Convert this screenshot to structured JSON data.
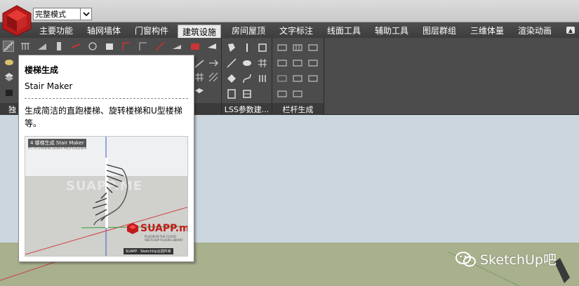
{
  "mode_select": {
    "value": "完整模式"
  },
  "menu": {
    "items": [
      {
        "label": "主要功能"
      },
      {
        "label": "轴网墙体"
      },
      {
        "label": "门窗构件"
      },
      {
        "label": "建筑设施",
        "active": true
      },
      {
        "label": "房间屋顶"
      },
      {
        "label": "文字标注"
      },
      {
        "label": "线面工具"
      },
      {
        "label": "辅助工具"
      },
      {
        "label": "图层群组"
      },
      {
        "label": "三维体量"
      },
      {
        "label": "渲染动画"
      }
    ],
    "close_icon": "▲"
  },
  "toolbar": {
    "groups": [
      {
        "label": "独"
      },
      {
        "label": ""
      },
      {
        "label": "LSS参数建..."
      },
      {
        "label": "栏杆生成"
      }
    ]
  },
  "tooltip": {
    "title": "楼梯生成",
    "subtitle": "Stair Maker",
    "description": "生成简洁的直跑楼梯、旋转楼梯和U型楼梯等。",
    "preview": {
      "header": "4 楼梯生成 Stair Maker",
      "url": "HTTP://WWW.SUAPP.ME/PLUGIN/4",
      "watermark": "SUAPP.ME",
      "brand": "SUAPP.me",
      "brand_sub": "PLUGIN-IN-THE-CLOUD",
      "brand_sub2": "SKETCHUP PLUGIN LIBRARY",
      "footer": "SUAPP · SketchUp云插件库"
    }
  },
  "watermark": {
    "text": "SketchUp吧"
  },
  "colors": {
    "menubar": "#444444",
    "toolbar": "#4c4c4c",
    "sky": "#cbd6de",
    "ground": "#a8b08e",
    "brand_red": "#c21a1a"
  }
}
